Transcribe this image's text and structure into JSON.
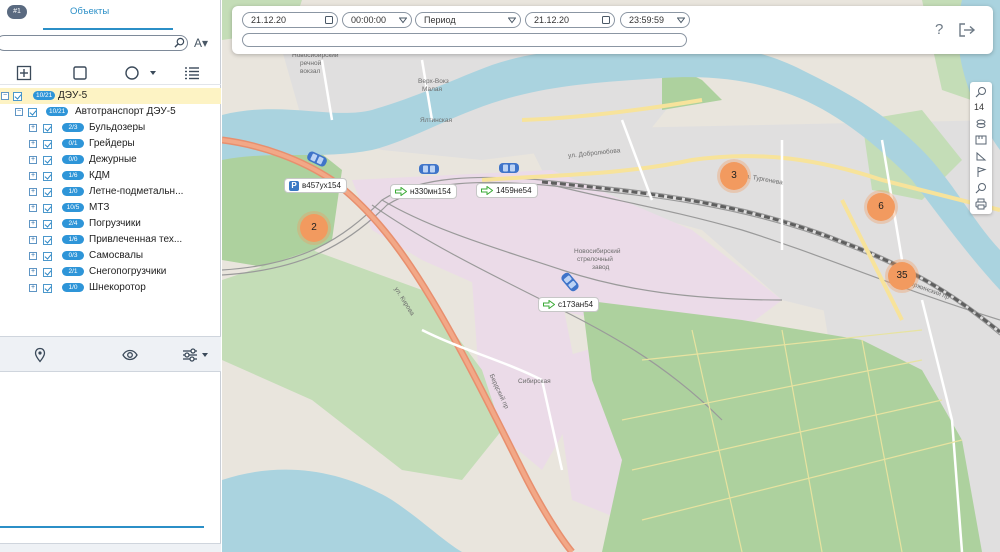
{
  "left_panel": {
    "badge": "#1",
    "tab_label": "Объекты",
    "search": {
      "value": "",
      "placeholder": ""
    },
    "tree": [
      {
        "count": "10/21",
        "label": "ДЭУ-5",
        "level": 0
      },
      {
        "count": "10/21",
        "label": "Автотранспорт ДЭУ-5",
        "level": 1
      },
      {
        "count": "2/3",
        "label": "Бульдозеры",
        "level": 2
      },
      {
        "count": "0/1",
        "label": "Грейдеры",
        "level": 2
      },
      {
        "count": "0/0",
        "label": "Дежурные",
        "level": 2
      },
      {
        "count": "1/6",
        "label": "КДМ",
        "level": 2
      },
      {
        "count": "1/0",
        "label": "Летне-подметальн...",
        "level": 2
      },
      {
        "count": "10/5",
        "label": "МТЗ",
        "level": 2
      },
      {
        "count": "2/4",
        "label": "Погрузчики",
        "level": 2
      },
      {
        "count": "1/6",
        "label": "Привлеченная тех...",
        "level": 2
      },
      {
        "count": "0/3",
        "label": "Самосвалы",
        "level": 2
      },
      {
        "count": "2/1",
        "label": "Снегопогрузчики",
        "level": 2
      },
      {
        "count": "1/0",
        "label": "Шнекоротор",
        "level": 2
      }
    ],
    "icons": {
      "toolbar": [
        "add-icon",
        "square-icon",
        "circle-icon",
        "list-icon"
      ],
      "middle": [
        "location-pin-icon",
        "eye-icon",
        "filter-settings-icon"
      ]
    }
  },
  "topbar": {
    "date_from": "21.12.20",
    "time_from": "00:00:00",
    "period": "Период",
    "date_to": "21.12.20",
    "time_to": "23:59:59",
    "help": "?"
  },
  "map": {
    "clusters": [
      "2",
      "3",
      "6",
      "35"
    ],
    "vehicles": [
      "в457ух154",
      "н330мн154",
      "1459не54",
      "с173ан54"
    ],
    "labels": {
      "l1": "Новосибирский",
      "l2": "речной",
      "l3": "вокзал",
      "l4": "Верх-Вокз",
      "l5": "Малая",
      "l6": "Ялтинская",
      "l7": "Новосибирский",
      "l8": "стрелочный",
      "l9": "завод",
      "l10": "Сибирская",
      "l11": "Бердский пр",
      "l12": "ул. Кирова",
      "l13": "ул. Добролюбова",
      "l14": "Дзержинский пр",
      "l15": "ул. Тургенева"
    },
    "zoom": "14",
    "colors": {
      "water": "#aad3df",
      "forest": "#add19e",
      "industrial": "#ebdbe8",
      "residential": "#e0dfdf",
      "road_major": "#e88f6e",
      "cluster": "#f29a5f",
      "accent": "#2b8fc7"
    }
  }
}
